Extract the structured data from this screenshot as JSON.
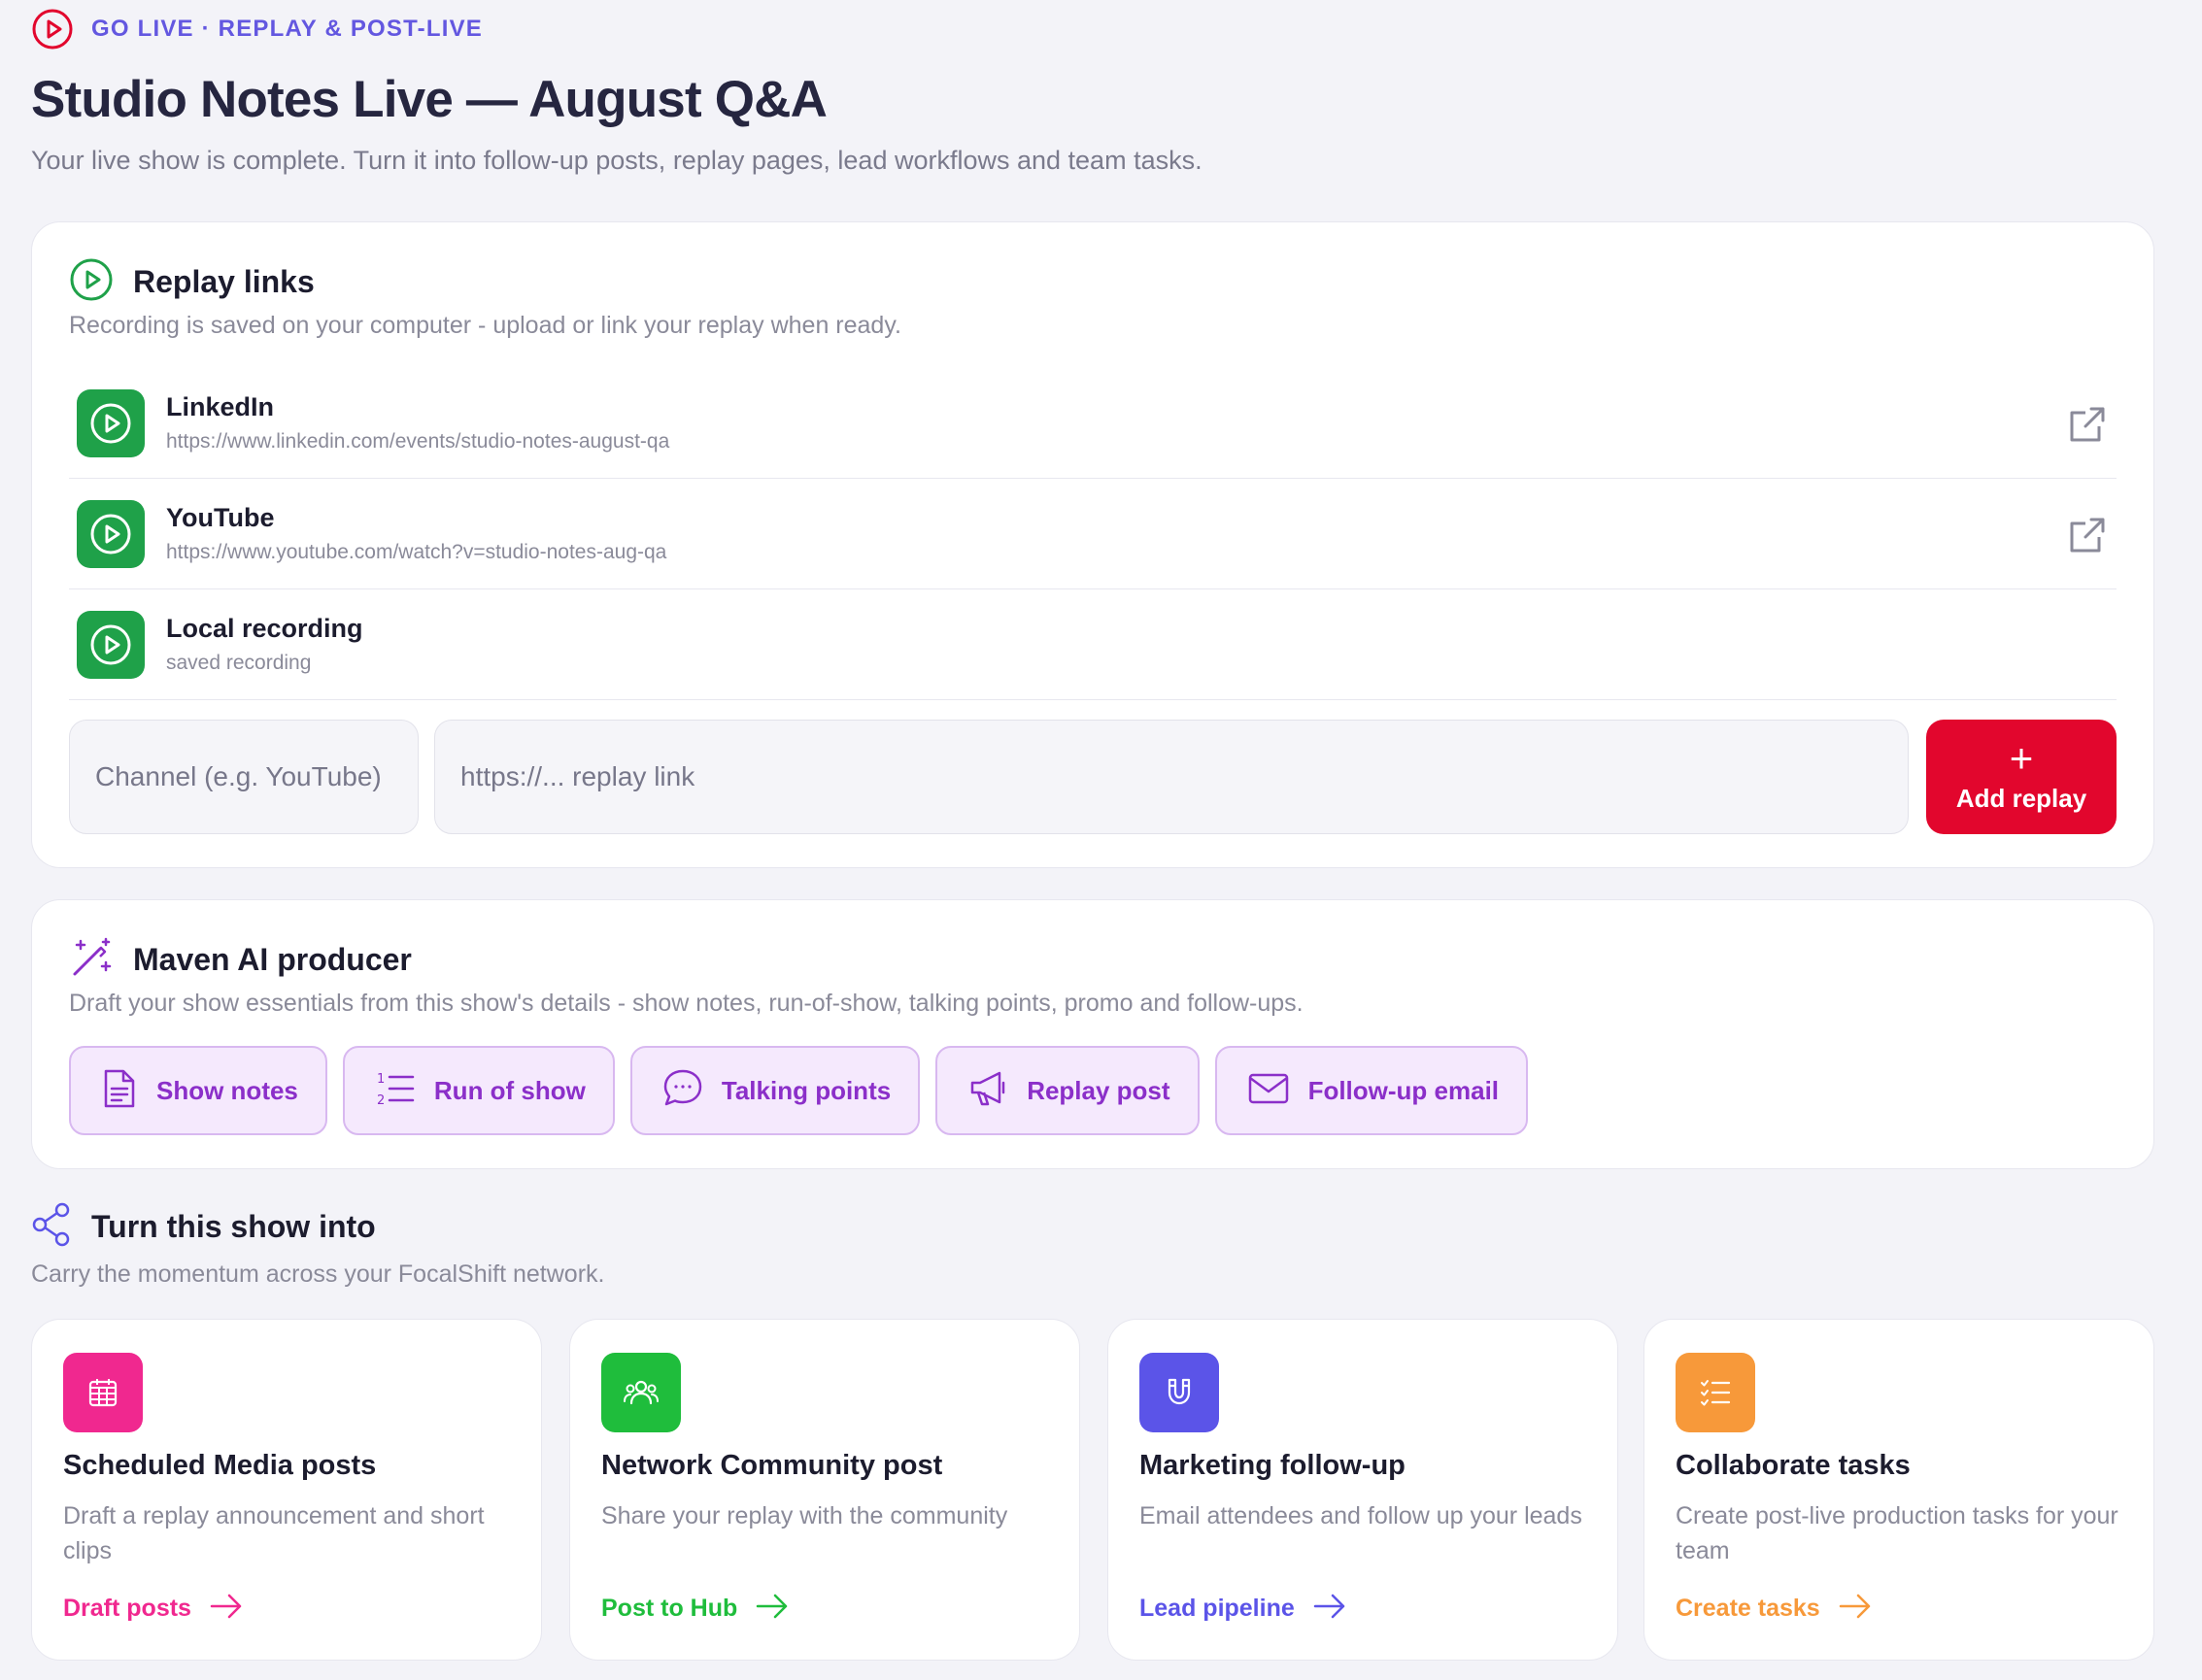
{
  "header": {
    "eyebrow": "GO LIVE · REPLAY & POST-LIVE",
    "title": "Studio Notes Live — August Q&A",
    "subtitle": "Your live show is complete. Turn it into follow-up posts, replay pages, lead workflows and team tasks."
  },
  "replay": {
    "title": "Replay links",
    "description": "Recording is saved on your computer - upload or link your replay when ready.",
    "items": [
      {
        "name": "LinkedIn",
        "url": "https://www.linkedin.com/events/studio-notes-august-qa"
      },
      {
        "name": "YouTube",
        "url": "https://www.youtube.com/watch?v=studio-notes-aug-qa"
      },
      {
        "name": "Local recording",
        "url": "saved recording"
      }
    ],
    "channel_placeholder": "Channel (e.g. YouTube)",
    "url_placeholder": "https://... replay link",
    "add_label": "Add replay",
    "add_icon": "+"
  },
  "ai": {
    "title": "Maven AI producer",
    "description": "Draft your show essentials from this show's details - show notes, run-of-show, talking points, promo and follow-ups.",
    "buttons": [
      {
        "label": "Show notes",
        "icon": "document-icon"
      },
      {
        "label": "Run of show",
        "icon": "numbered-list-icon"
      },
      {
        "label": "Talking points",
        "icon": "chat-bubble-icon"
      },
      {
        "label": "Replay post",
        "icon": "megaphone-icon"
      },
      {
        "label": "Follow-up email",
        "icon": "envelope-icon"
      }
    ]
  },
  "turn_into": {
    "title": "Turn this show into",
    "description": "Carry the momentum across your FocalShift network.",
    "cards": [
      {
        "name": "Scheduled Media posts",
        "description": "Draft a replay announcement and short clips",
        "link": "Draft posts",
        "color": "#f0288f",
        "icon": "calendar-icon"
      },
      {
        "name": "Network Community post",
        "description": "Share your replay with the community",
        "link": "Post to Hub",
        "color": "#1fbd3c",
        "icon": "community-icon"
      },
      {
        "name": "Marketing follow-up",
        "description": "Email attendees and follow up your leads",
        "link": "Lead pipeline",
        "color": "#5b54e8",
        "icon": "magnet-icon"
      },
      {
        "name": "Collaborate tasks",
        "description": "Create post-live production tasks for your team",
        "link": "Create tasks",
        "color": "#f7993a",
        "icon": "checklist-icon"
      }
    ]
  },
  "colors": {
    "accent": "#6357e0",
    "live_red": "#e2062d",
    "replay_green": "#1fa149",
    "ai_purple": "#8b2fc9"
  }
}
